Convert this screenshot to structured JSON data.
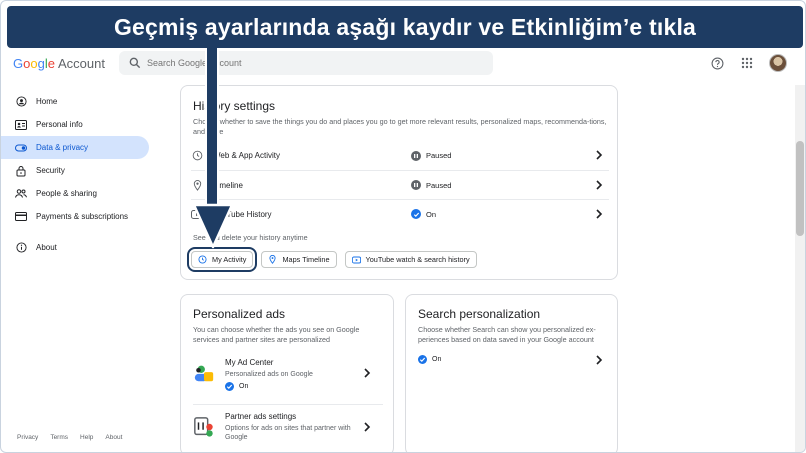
{
  "banner": {
    "text": "Geçmiş ayarlarında aşağı kaydır ve Etkinliğim’e tıkla"
  },
  "header": {
    "logo_google": [
      "G",
      "o",
      "o",
      "g",
      "l",
      "e"
    ],
    "logo_account": "Account",
    "search_placeholder": "Search Google Account"
  },
  "sidebar": {
    "items": [
      {
        "label": "Home",
        "icon": "home-icon"
      },
      {
        "label": "Personal info",
        "icon": "id-card-icon"
      },
      {
        "label": "Data & privacy",
        "icon": "toggle-icon",
        "active": true
      },
      {
        "label": "Security",
        "icon": "lock-icon"
      },
      {
        "label": "People & sharing",
        "icon": "people-icon"
      },
      {
        "label": "Payments & subscriptions",
        "icon": "card-icon"
      },
      {
        "label": "About",
        "icon": "info-icon"
      }
    ],
    "footer": [
      "Privacy",
      "Terms",
      "Help",
      "About"
    ]
  },
  "history": {
    "title": "History settings",
    "description": "Choose whether to save the things you do and places you go to get more relevant results, personalized maps, recommenda-tions, and more",
    "rows": [
      {
        "label": "Web & App Activity",
        "status": "Paused"
      },
      {
        "label": "Timeline",
        "status": "Paused"
      },
      {
        "label": "YouTube History",
        "status": "On"
      }
    ],
    "manage_label": "See and delete your history anytime",
    "chips": [
      "My Activity",
      "Maps Timeline",
      "YouTube watch & search history"
    ]
  },
  "ads": {
    "title": "Personalized ads",
    "description": "You can choose whether the ads you see on Google services and partner sites are personalized",
    "items": [
      {
        "title": "My Ad Center",
        "sub": "Personalized ads on Google",
        "status": "On"
      },
      {
        "title": "Partner ads settings",
        "sub": "Options for ads on sites that partner with Google"
      }
    ]
  },
  "search_personalization": {
    "title": "Search personalization",
    "description": "Choose whether Search can show you personalized ex-periences based on data saved in your Google account",
    "status": "On"
  },
  "colors": {
    "banner": "#1e3c63",
    "active_nav": "#d3e3fd",
    "accent": "#1a73e8",
    "paused": "#5f6368"
  }
}
